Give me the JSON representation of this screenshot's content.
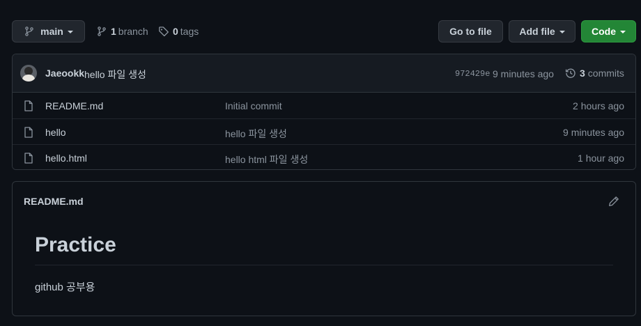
{
  "toolbar": {
    "branch_button": "main",
    "branch_count": "1",
    "branch_label": "branch",
    "tag_count": "0",
    "tag_label": "tags",
    "go_to_file": "Go to file",
    "add_file": "Add file",
    "code": "Code"
  },
  "latest_commit": {
    "author": "Jaeookk",
    "message": "hello 파일 생성",
    "sha": "972429e",
    "time": "9 minutes ago",
    "commit_count": "3",
    "commit_label": "commits"
  },
  "files": [
    {
      "name": "README.md",
      "message": "Initial commit",
      "time": "2 hours ago"
    },
    {
      "name": "hello",
      "message": "hello 파일 생성",
      "time": "9 minutes ago"
    },
    {
      "name": "hello.html",
      "message": "hello html 파일 생성",
      "time": "1 hour ago"
    }
  ],
  "readme": {
    "filename": "README.md",
    "heading": "Practice",
    "paragraph": "github 공부용"
  },
  "icons": {
    "branch": "git-branch-icon",
    "tag": "tag-icon",
    "history": "history-icon",
    "file": "file-icon",
    "edit": "pencil-icon"
  },
  "colors": {
    "background": "#0d1117",
    "code_button": "#238636",
    "border": "#30363d"
  }
}
